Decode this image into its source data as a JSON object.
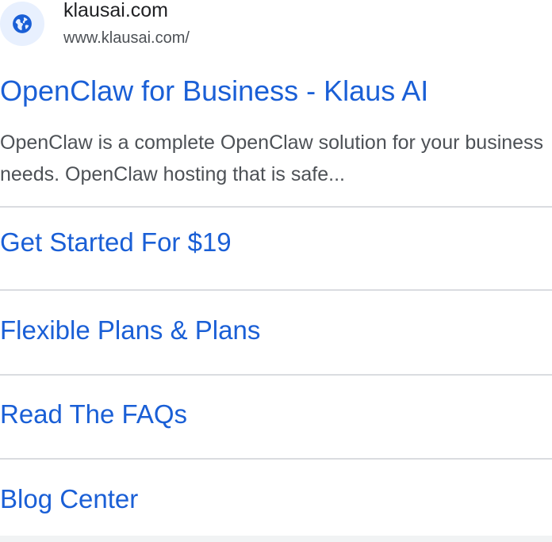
{
  "site": {
    "name": "klausai.com",
    "url": "www.klausai.com/",
    "icon": "globe-icon"
  },
  "result": {
    "title": "OpenClaw for Business - Klaus AI",
    "snippet": "OpenClaw is a complete OpenClaw solution for your business needs. OpenClaw hosting that is safe..."
  },
  "sitelinks": [
    {
      "label": "Get Started For $19"
    },
    {
      "label": "Flexible Plans & Plans"
    },
    {
      "label": "Read The FAQs"
    },
    {
      "label": "Blog Center"
    }
  ],
  "colors": {
    "link": "#1a5fd6",
    "text": "#202124",
    "muted": "#4d5156",
    "divider": "#dadce0",
    "favicon_bg": "#e8f0fe",
    "favicon_fg": "#1a5fd6"
  }
}
